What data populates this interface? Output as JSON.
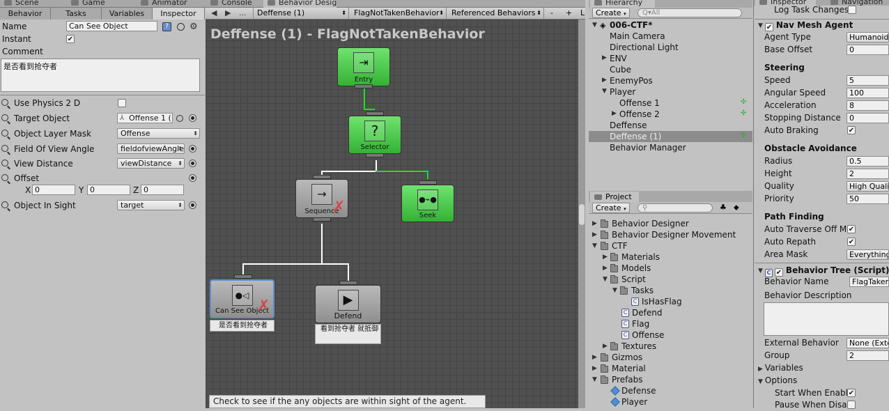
{
  "top_tabs": {
    "scene": "Scene",
    "game": "Game",
    "animator": "Animator",
    "console": "Console",
    "behavior_designer": "Behavior Desig",
    "hierarchy": "Hierarchy",
    "inspector": "Inspector",
    "navigation": "Navigation"
  },
  "bd_panel": {
    "tabs": [
      "Behavior",
      "Tasks",
      "Variables",
      "Inspector"
    ],
    "name_label": "Name",
    "name_value": "Can See Object",
    "instant_label": "Instant",
    "comment_label": "Comment",
    "comment_value": "是否看到抢夺者",
    "props": [
      {
        "label": "Use Physics 2 D"
      },
      {
        "label": "Target Object",
        "value": "Offense 1 ("
      },
      {
        "label": "Object Layer Mask",
        "value": "Offense"
      },
      {
        "label": "Field Of View Angle",
        "value": "fieldofviewAngle"
      },
      {
        "label": "View Distance",
        "value": "viewDistance"
      },
      {
        "label": "Offset"
      },
      {
        "label": "Object In Sight",
        "value": "target"
      }
    ],
    "offset": {
      "x_label": "X",
      "x": "0",
      "y_label": "Y",
      "y": "0",
      "z_label": "Z",
      "z": "0"
    }
  },
  "graph_toolbar": {
    "prev": "◀",
    "next": "▶",
    "more": "...",
    "object": "Deffense (1)",
    "behavior": "FlagNotTakenBehavior",
    "referenced": "Referenced Behaviors",
    "minus": "-",
    "plus": "+",
    "lock": "L"
  },
  "graph": {
    "title": "Deffense (1) - FlagNotTakenBehavior",
    "nodes": {
      "entry": "Entry",
      "selector": "Selector",
      "sequence": "Sequence",
      "seek": "Seek",
      "can_see": "Can See Object",
      "can_see_comment": "是否看到抢夺者",
      "defend": "Defend",
      "defend_comment": "看到抢夺者 就抵御"
    },
    "tooltip": "Check to see if the any objects are within sight of the agent."
  },
  "hierarchy": {
    "create": "Create",
    "search_placeholder": "Q▾All",
    "scene": "006-CTF*",
    "items": [
      "Main Camera",
      "Directional Light",
      "ENV",
      "Cube",
      "EnemyPos",
      "Player",
      "Offense 1",
      "Offense 2",
      "Deffense",
      "Deffense (1)",
      "Behavior Manager"
    ]
  },
  "project": {
    "tab": "Project",
    "create": "Create",
    "items": [
      "Behavior Designer",
      "Behavior Designer Movement",
      "CTF",
      "Materials",
      "Models",
      "Script",
      "Tasks",
      "IsHasFlag",
      "Defend",
      "Flag",
      "Offense",
      "Textures",
      "Gizmos",
      "Material",
      "Prefabs",
      "Defense",
      "Player"
    ]
  },
  "inspector": {
    "log_task_changes": "Log Task Changes",
    "nav_title": "Nav Mesh Agent",
    "agent_type_label": "Agent Type",
    "agent_type": "Humanoid",
    "base_offset_label": "Base Offset",
    "base_offset": "0",
    "steering": "Steering",
    "speed_label": "Speed",
    "speed": "5",
    "angular_label": "Angular Speed",
    "angular": "100",
    "accel_label": "Acceleration",
    "accel": "8",
    "stopping_label": "Stopping Distance",
    "stopping": "0",
    "auto_braking": "Auto Braking",
    "obstacle": "Obstacle Avoidance",
    "radius_label": "Radius",
    "radius": "0.5",
    "height_label": "Height",
    "height": "2",
    "quality_label": "Quality",
    "quality": "High Quality",
    "priority_label": "Priority",
    "priority": "50",
    "pathfinding": "Path Finding",
    "auto_traverse": "Auto Traverse Off Me",
    "auto_repath": "Auto Repath",
    "area_mask_label": "Area Mask",
    "area_mask": "Everything",
    "bt_title": "Behavior Tree (Script)",
    "bname_label": "Behavior Name",
    "bname": "FlagTaken",
    "bdesc_label": "Behavior Description",
    "external_label": "External Behavior",
    "external": "None (Exte",
    "group_label": "Group",
    "group": "2",
    "variables": "Variables",
    "options": "Options",
    "start_when": "Start When Enable",
    "pause_when": "Pause When Disal"
  }
}
